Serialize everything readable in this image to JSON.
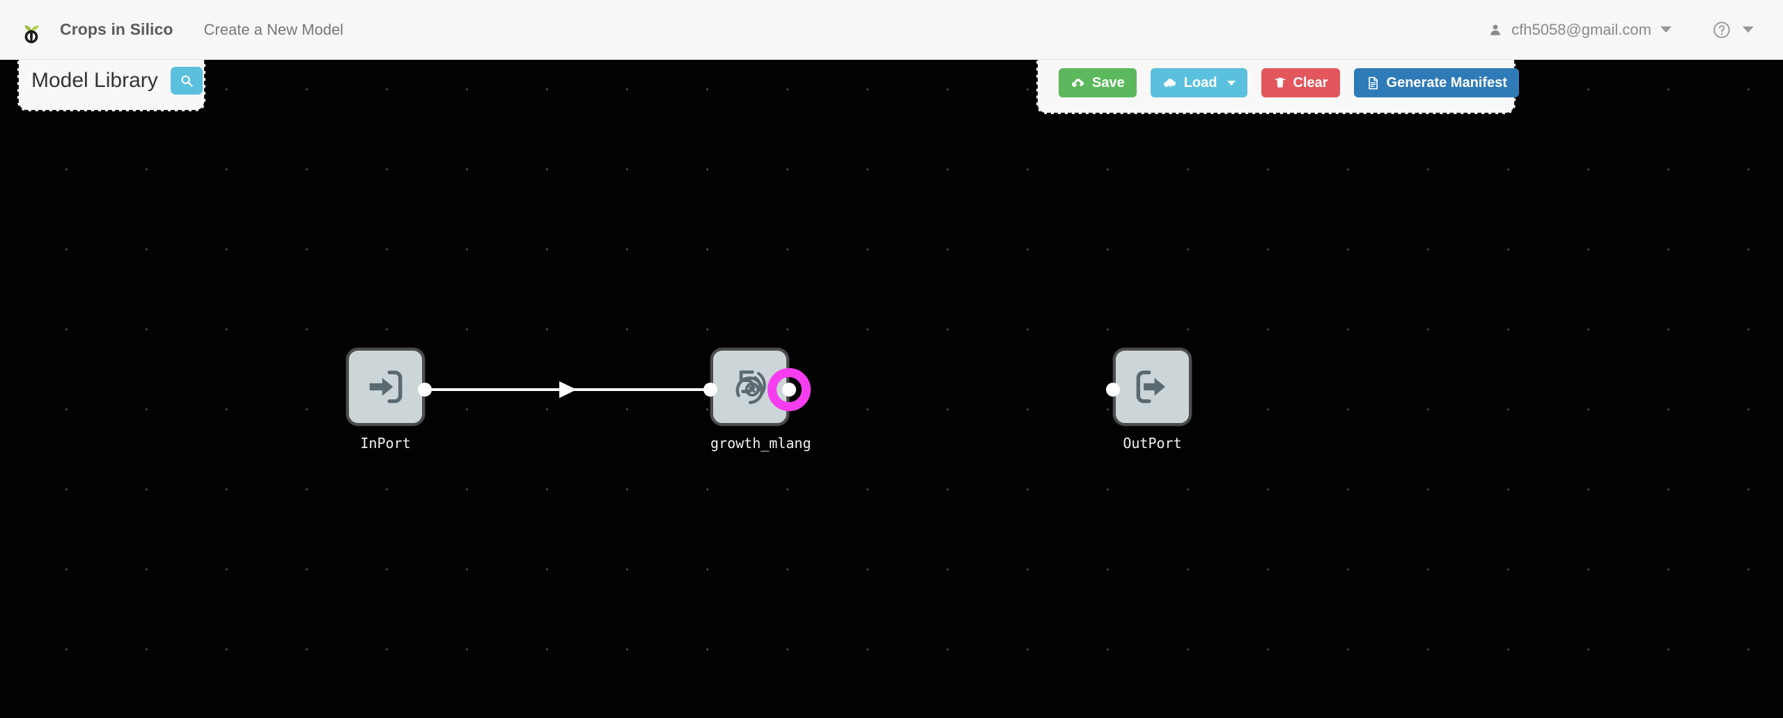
{
  "header": {
    "logo_icon": "sprout-power-logo",
    "brand": "Crops in Silico",
    "nav_item": "Create a New Model",
    "user_icon": "person-icon",
    "user_email": "cfh5058@gmail.com",
    "user_caret_icon": "chevron-down-icon",
    "help_icon": "question-circle-icon",
    "help_caret_icon": "chevron-down-icon"
  },
  "model_library": {
    "title": "Model Library",
    "search_icon": "search-icon"
  },
  "toolbar": {
    "save_label": "Save",
    "save_icon": "cloud-upload-icon",
    "load_label": "Load",
    "load_icon": "cloud-download-icon",
    "load_caret_icon": "chevron-down-icon",
    "clear_label": "Clear",
    "clear_icon": "trash-icon",
    "manifest_label": "Generate Manifest",
    "manifest_icon": "document-icon"
  },
  "graph": {
    "nodes": [
      {
        "label": "InPort",
        "icon": "sign-in-arrow-icon"
      },
      {
        "label": "growth_mlang",
        "icon": "rate-5x-icon"
      },
      {
        "label": "OutPort",
        "icon": "sign-out-arrow-icon"
      }
    ],
    "highlight_color": "#f63ef0",
    "link_color": "#ffffff"
  },
  "colors": {
    "canvas_background": "#020202",
    "node_fill": "#ccd6d8",
    "node_border": "#4d4d4d",
    "accent_blue": "#5bc0de",
    "save_green": "#5cb85c",
    "clear_red": "#e3565c",
    "manifest_blue": "#2e7bb8"
  }
}
